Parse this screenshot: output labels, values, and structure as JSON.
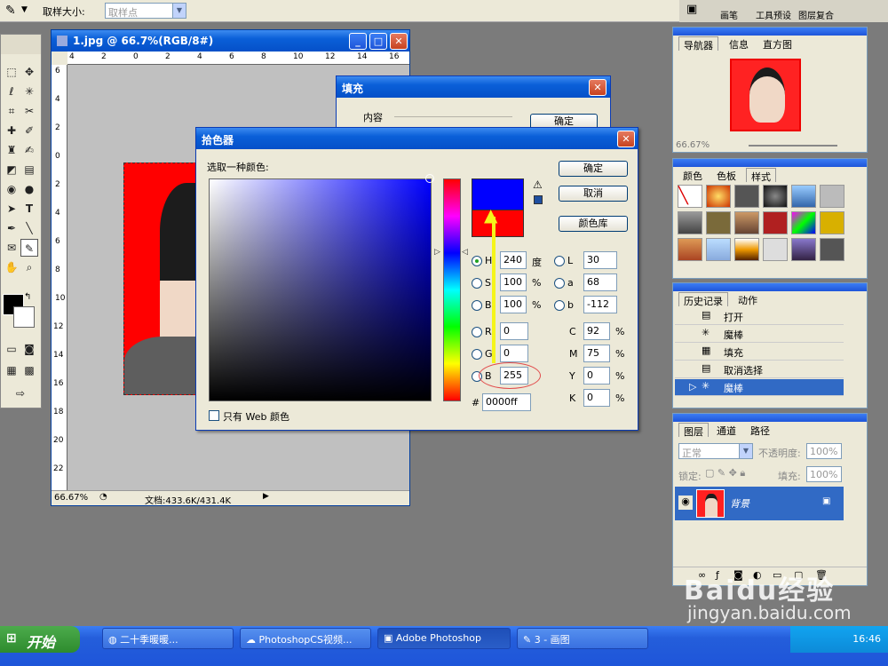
{
  "options_bar": {
    "label": "取样大小:",
    "sample_value": "取样点"
  },
  "document": {
    "title": "1.jpg @ 66.7%(RGB/8#)",
    "zoom": "66.67%",
    "doc_info": "文档:433.6K/431.4K",
    "ruler_h": [
      "4",
      "2",
      "0",
      "2",
      "4",
      "6",
      "8",
      "10",
      "12",
      "14",
      "16"
    ],
    "ruler_v": [
      "6",
      "4",
      "2",
      "0",
      "2",
      "4",
      "6",
      "8",
      "10",
      "12",
      "14",
      "16",
      "18",
      "20",
      "22"
    ]
  },
  "fill_dialog": {
    "title": "填充",
    "group_label": "内容",
    "ok": "确定"
  },
  "picker": {
    "title": "拾色器",
    "prompt": "选取一种颜色:",
    "ok": "确定",
    "cancel": "取消",
    "library": "颜色库",
    "web_only": "只有 Web 颜色",
    "hsb": [
      {
        "key": "H",
        "value": "240",
        "unit": "度",
        "selected": true
      },
      {
        "key": "S",
        "value": "100",
        "unit": "%"
      },
      {
        "key": "B",
        "value": "100",
        "unit": "%"
      }
    ],
    "rgb": [
      {
        "key": "R",
        "value": "0"
      },
      {
        "key": "G",
        "value": "0"
      },
      {
        "key": "B",
        "value": "255"
      }
    ],
    "lab": [
      {
        "key": "L",
        "value": "30"
      },
      {
        "key": "a",
        "value": "68"
      },
      {
        "key": "b",
        "value": "-112"
      }
    ],
    "cmyk": [
      {
        "key": "C",
        "value": "92",
        "unit": "%"
      },
      {
        "key": "M",
        "value": "75",
        "unit": "%"
      },
      {
        "key": "Y",
        "value": "0",
        "unit": "%"
      },
      {
        "key": "K",
        "value": "0",
        "unit": "%"
      }
    ],
    "hex_label": "#",
    "hex": "0000ff",
    "new_color": "#0000ff",
    "old_color": "#ff0000"
  },
  "panels": {
    "top_tabs": [
      "画笔",
      "工具预设",
      "图层复合"
    ],
    "navigator": {
      "tabs": [
        "导航器",
        "信息",
        "直方图"
      ],
      "zoom": "66.67%"
    },
    "swatches": {
      "tabs": [
        "颜色",
        "色板",
        "样式"
      ]
    },
    "history": {
      "tabs": [
        "历史记录",
        "动作"
      ],
      "items": [
        {
          "label": "打开",
          "icon": "document-icon"
        },
        {
          "label": "魔棒",
          "icon": "magic-wand-icon"
        },
        {
          "label": "填充",
          "icon": "fill-icon"
        },
        {
          "label": "取消选择",
          "icon": "document-icon"
        },
        {
          "label": "魔棒",
          "icon": "magic-wand-icon",
          "selected": true
        }
      ]
    },
    "layers": {
      "tabs": [
        "图层",
        "通道",
        "路径"
      ],
      "blend_mode": "正常",
      "opacity_label": "不透明度:",
      "opacity": "100%",
      "lock_label": "锁定:",
      "fill_label": "填充:",
      "fill": "100%",
      "layer_name": "背景"
    }
  },
  "taskbar": {
    "start": "开始",
    "tasks": [
      {
        "label": "二十季暖暖..."
      },
      {
        "label": "PhotoshopCS视频..."
      },
      {
        "label": "Adobe Photoshop",
        "active": true
      },
      {
        "label": "3 - 画图"
      }
    ],
    "clock": "16:46"
  },
  "watermark": {
    "brand": "Baidu经验",
    "url": "jingyan.baidu.com"
  }
}
